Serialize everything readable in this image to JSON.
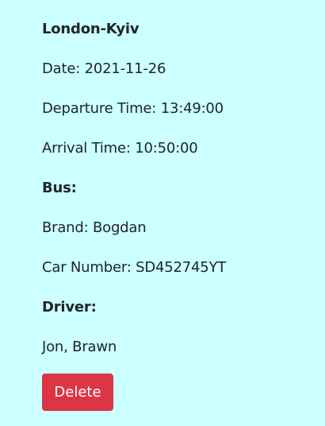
{
  "trip": {
    "route": "London-Kyiv",
    "date": "Date: 2021-11-26",
    "departure": "Departure Time: 13:49:00",
    "arrival": "Arrival Time: 10:50:00"
  },
  "bus": {
    "heading": "Bus:",
    "brand": "Brand: Bogdan",
    "car_number": "Car Number: SD452745YT"
  },
  "driver": {
    "heading": "Driver:",
    "name": "Jon, Brawn"
  },
  "actions": {
    "delete_label": "Delete"
  },
  "colors": {
    "background": "#ccffff",
    "danger": "#dc3545",
    "text": "#212529"
  }
}
